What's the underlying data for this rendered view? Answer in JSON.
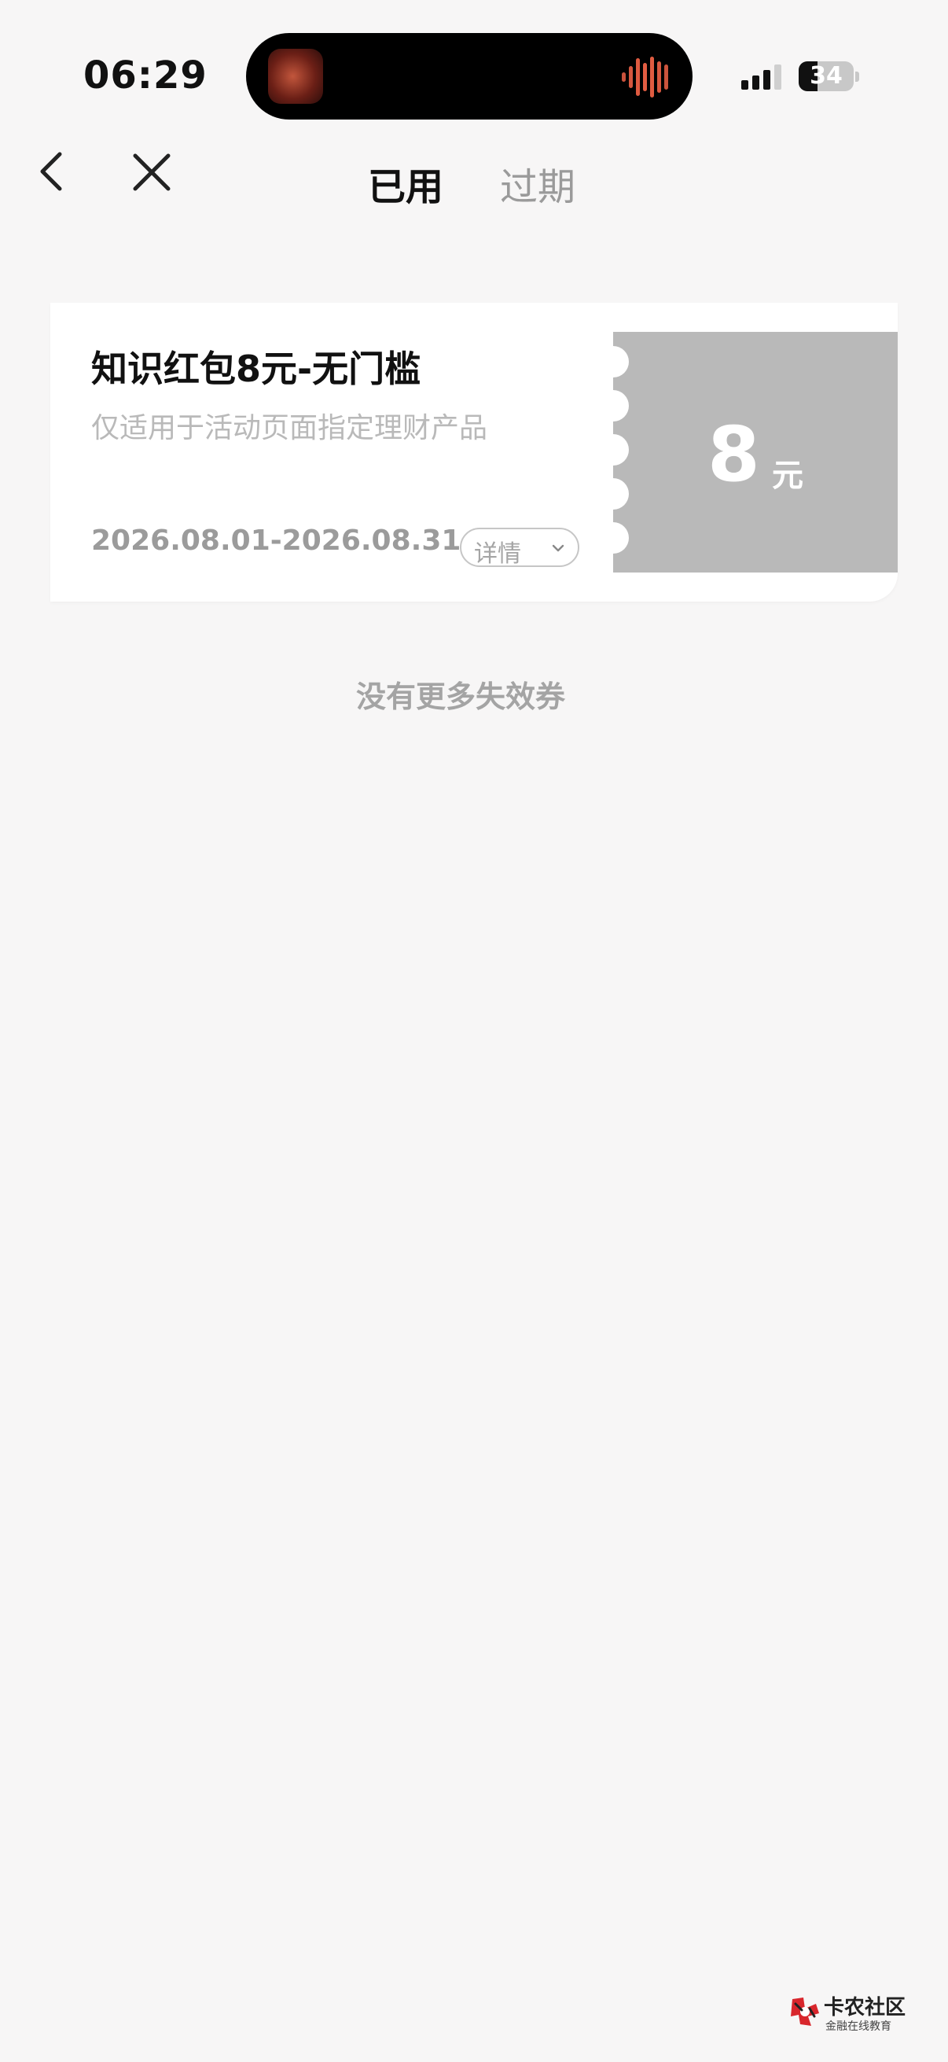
{
  "status_bar": {
    "time": "06:29",
    "battery_level": "34",
    "battery_fraction": 0.34,
    "now_playing_icon": "album-art-thumbnail",
    "audio_icon": "waveform-icon"
  },
  "nav": {
    "back_icon": "chevron-left-icon",
    "close_icon": "close-icon",
    "tabs": [
      {
        "label": "已用",
        "active": true
      },
      {
        "label": "过期",
        "active": false
      }
    ]
  },
  "coupon": {
    "title": "知识红包8元-无门槛",
    "description": "仅适用于活动页面指定理财产品",
    "validity": "2026.08.01-2026.08.31",
    "detail_label": "详情",
    "amount": "8",
    "unit": "元"
  },
  "list_footer": "没有更多失效券",
  "watermark": {
    "name": "卡农社区",
    "subtitle": "金融在线教育"
  },
  "colors": {
    "background": "#f7f6f6",
    "amount_panel": "#b9b9b9",
    "island_accent": "#e0543a"
  }
}
